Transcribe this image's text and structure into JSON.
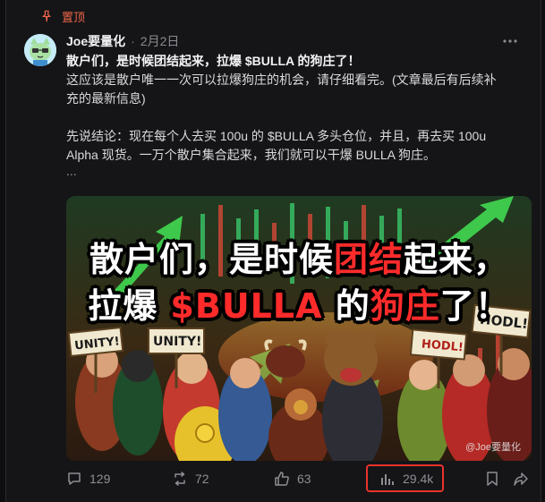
{
  "post": {
    "pinned_label": "置顶",
    "author": "Joe要量化",
    "separator": "·",
    "date": "2月2日",
    "title": "散户们，是时候团结起来，拉爆 $BULLA 的狗庄了！",
    "lines": [
      "这应该是散户唯一一次可以拉爆狗庄的机会，请仔细看完。(文章最后有后续补",
      "充的最新信息)"
    ],
    "conclusion_lines": [
      "先说结论：现在每个人去买 100u 的 $BULLA 多头仓位，并且，再去买 100u",
      "Alpha 现货。一万个散户集合起来，我们就可以干爆 BULLA 狗庄。"
    ],
    "ellipsis": "...",
    "image": {
      "headline_line1_a": "散户们，是时候",
      "headline_line1_red": "团结",
      "headline_line1_b": "起来，",
      "headline_line2_a": "拉爆 ",
      "headline_line2_red1": "$BULLA",
      "headline_line2_b": " 的",
      "headline_line2_red2": "狗庄",
      "headline_line2_c": "了！",
      "sign_left1": "UNITY!",
      "sign_left2": "UNITY!",
      "sign_right1": "HODL!",
      "sign_right2": "HODL!",
      "watermark": "@Joe要量化"
    }
  },
  "actions": {
    "replies": "129",
    "reposts": "72",
    "likes": "63",
    "views": "29.4k"
  },
  "colors": {
    "accent_red": "#e8322c",
    "pin_red": "#f0654a"
  }
}
